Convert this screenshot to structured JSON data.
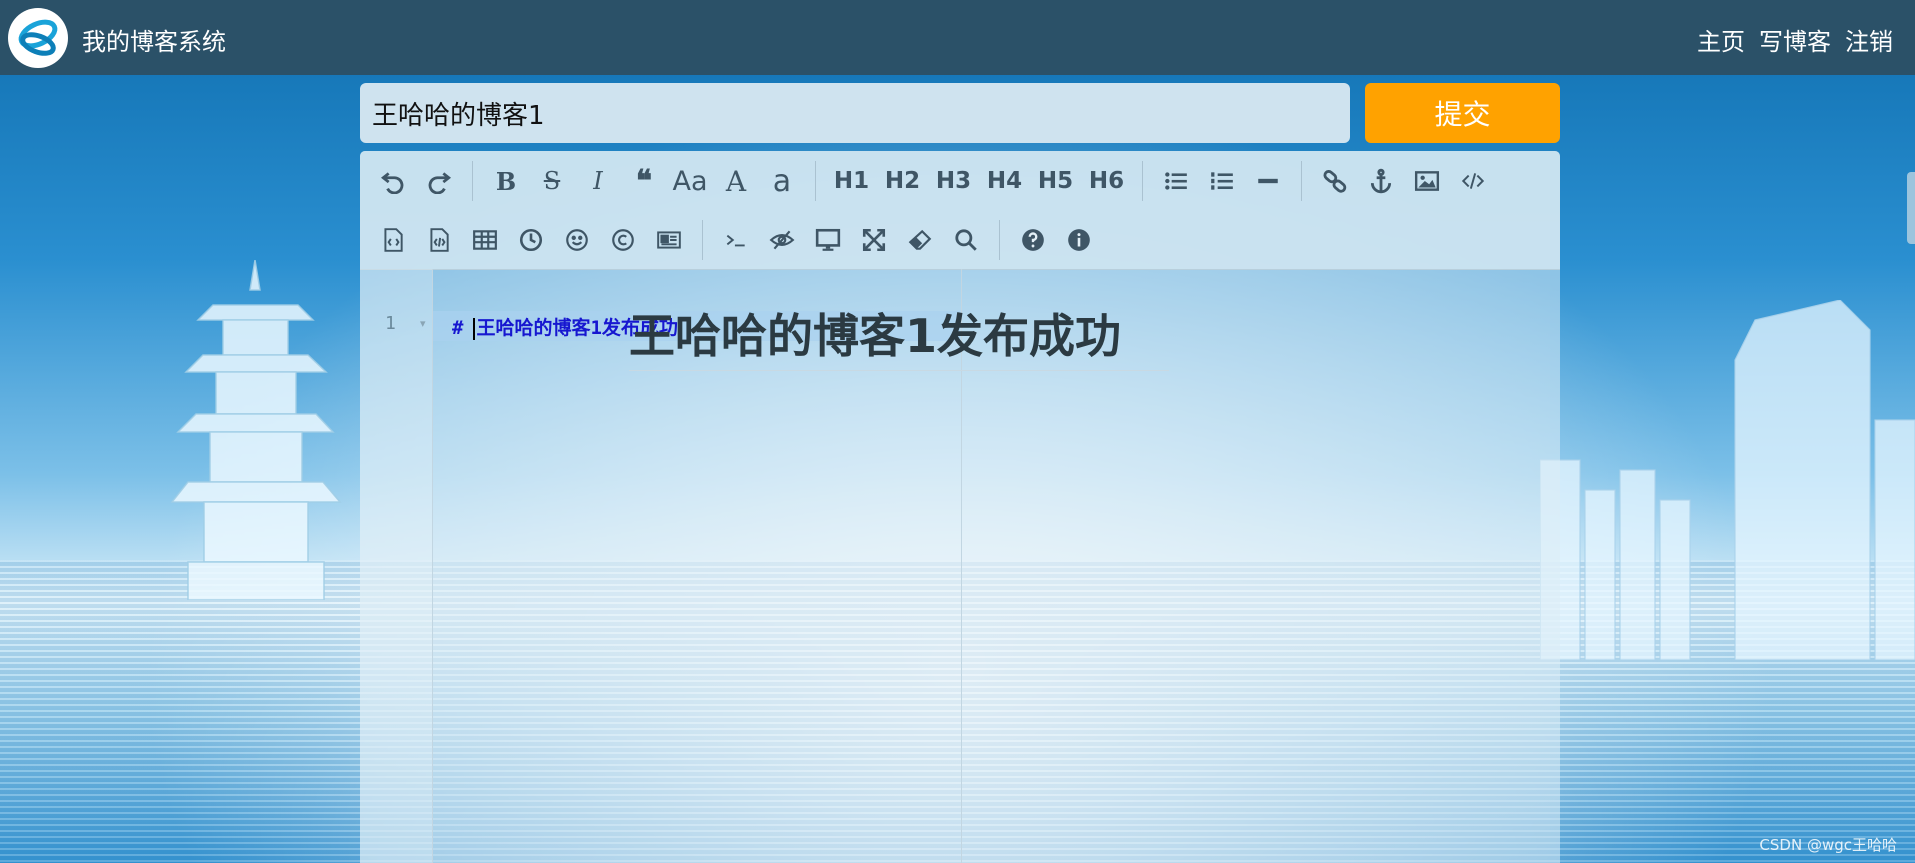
{
  "nav": {
    "brand": "我的博客系统",
    "links": [
      "主页",
      "写博客",
      "注销"
    ]
  },
  "editor": {
    "title_value": "王哈哈的博客1",
    "submit_label": "提交",
    "toolbar_row1": [
      {
        "icon": "undo-icon"
      },
      {
        "icon": "redo-icon"
      },
      {
        "icon": "bold-icon",
        "label": "B"
      },
      {
        "icon": "strikethrough-icon",
        "label": "S"
      },
      {
        "icon": "italic-icon",
        "label": "I"
      },
      {
        "icon": "quote-icon",
        "label": "❝"
      },
      {
        "icon": "uppercase-icon",
        "label": "Aa"
      },
      {
        "icon": "font-size-upper-icon",
        "label": "A"
      },
      {
        "icon": "lowercase-icon",
        "label": "a"
      },
      {
        "icon": "heading-1",
        "label": "H1"
      },
      {
        "icon": "heading-2",
        "label": "H2"
      },
      {
        "icon": "heading-3",
        "label": "H3"
      },
      {
        "icon": "heading-4",
        "label": "H4"
      },
      {
        "icon": "heading-5",
        "label": "H5"
      },
      {
        "icon": "heading-6",
        "label": "H6"
      },
      {
        "icon": "unordered-list-icon"
      },
      {
        "icon": "ordered-list-icon"
      },
      {
        "icon": "horizontal-rule-icon"
      },
      {
        "icon": "link-icon"
      },
      {
        "icon": "anchor-icon"
      },
      {
        "icon": "image-icon"
      },
      {
        "icon": "code-icon"
      }
    ],
    "toolbar_row2": [
      {
        "icon": "code-block-icon"
      },
      {
        "icon": "preformatted-code-icon"
      },
      {
        "icon": "table-icon"
      },
      {
        "icon": "datetime-icon"
      },
      {
        "icon": "emoji-icon"
      },
      {
        "icon": "html-entities-icon"
      },
      {
        "icon": "pagebreak-icon"
      },
      {
        "icon": "goto-line-icon"
      },
      {
        "icon": "watch-icon"
      },
      {
        "icon": "preview-icon"
      },
      {
        "icon": "fullscreen-icon"
      },
      {
        "icon": "clear-icon"
      },
      {
        "icon": "search-icon"
      },
      {
        "icon": "help-icon"
      },
      {
        "icon": "info-icon"
      }
    ],
    "line_number": "1",
    "markdown_hash": "#",
    "markdown_text": "王哈哈的博客1发布成功",
    "preview_heading": "王哈哈的博客1发布成功"
  },
  "watermark": "CSDN @wgc王哈哈",
  "colors": {
    "nav_bg": "#2b5168",
    "submit_bg": "#ffa200",
    "code_text": "#1717d0"
  }
}
